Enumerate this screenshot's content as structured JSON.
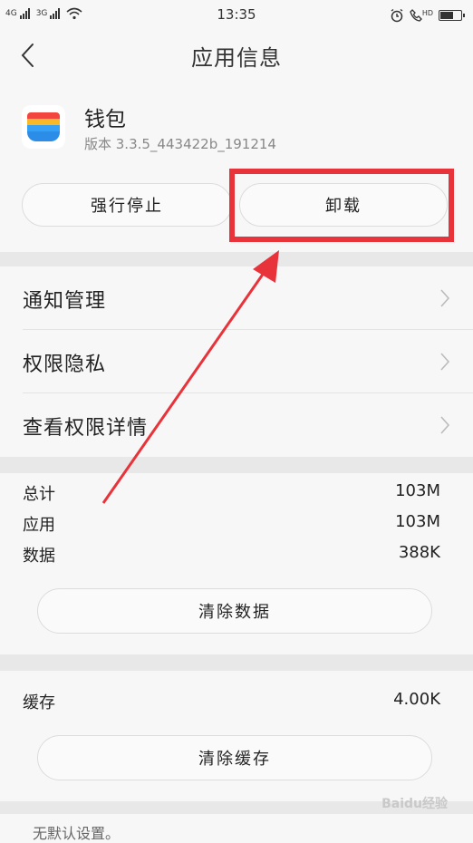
{
  "status_bar": {
    "sim1": "4G",
    "sim2": "3G",
    "time": "13:35",
    "hd": "HD",
    "icons": [
      "signal-icon",
      "wifi-icon",
      "alarm-icon",
      "call-hd-icon",
      "battery-icon"
    ],
    "battery_level": 0.7
  },
  "header": {
    "title": "应用信息",
    "back_icon": "chevron-left-icon"
  },
  "app": {
    "name": "钱包",
    "version": "版本 3.3.5_443422b_191214",
    "icon_colors": [
      "#f2453d",
      "#f7b928",
      "#35a0f5"
    ]
  },
  "actions": {
    "force_stop": "强行停止",
    "uninstall": "卸载"
  },
  "menu": {
    "items": [
      {
        "label": "通知管理"
      },
      {
        "label": "权限隐私"
      },
      {
        "label": "查看权限详情"
      }
    ]
  },
  "storage": {
    "rows": [
      {
        "label": "总计",
        "value": "103M"
      },
      {
        "label": "应用",
        "value": "103M"
      },
      {
        "label": "数据",
        "value": "388K"
      }
    ],
    "clear_data": "清除数据"
  },
  "cache": {
    "label": "缓存",
    "value": "4.00K",
    "clear_cache": "清除缓存"
  },
  "footer": {
    "default_text": "无默认设置。"
  },
  "watermark": "Baidu经验",
  "annotation": {
    "color": "#e8333a"
  }
}
